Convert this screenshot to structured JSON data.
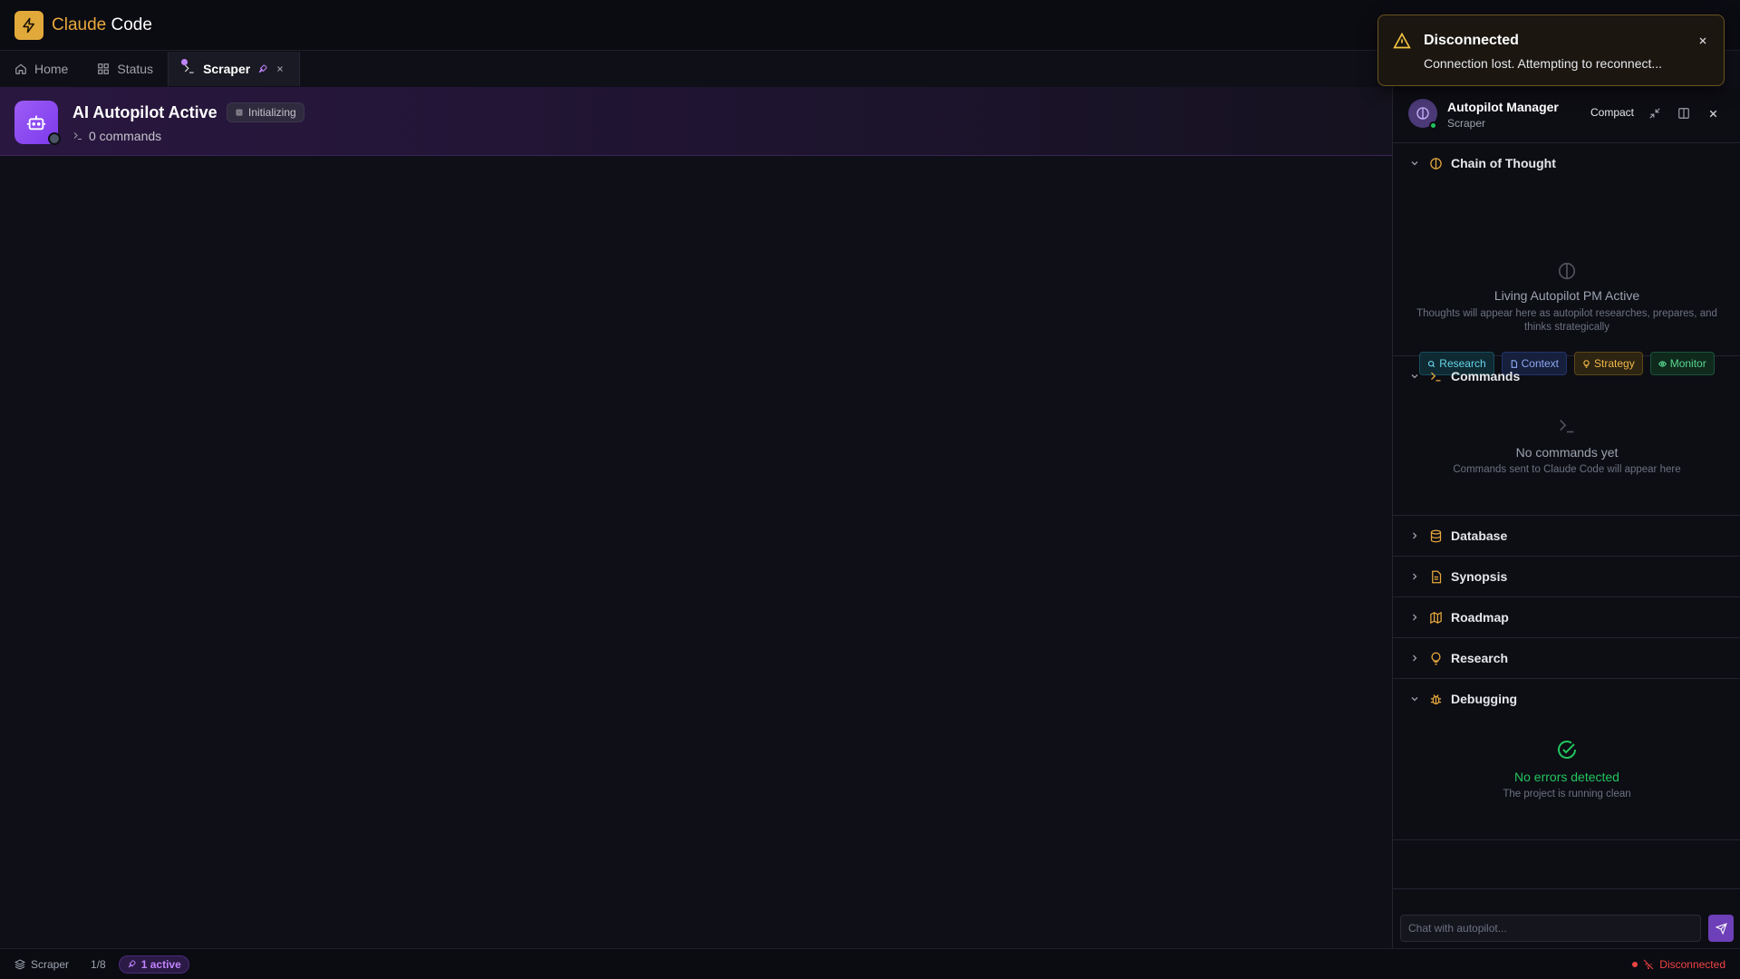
{
  "app": {
    "title_brand": "Claude",
    "title_rest": " Code"
  },
  "tabs": [
    {
      "label": "Home",
      "icon": "home-icon"
    },
    {
      "label": "Status",
      "icon": "grid-icon"
    },
    {
      "label": "Scraper",
      "icon": "terminal-icon",
      "active": true
    }
  ],
  "banner": {
    "title": "AI Autopilot Active",
    "badge": "Initializing",
    "commands_count": "0 commands"
  },
  "panel": {
    "title": "Autopilot Manager",
    "subtitle": "Scraper",
    "compact_label": "Compact",
    "sections": {
      "chain": {
        "title": "Chain of Thought",
        "empty_title": "Living Autopilot PM Active",
        "empty_sub": "Thoughts will appear here as autopilot researches, prepares, and thinks strategically",
        "chips": [
          "Research",
          "Context",
          "Strategy",
          "Monitor"
        ]
      },
      "commands": {
        "title": "Commands",
        "empty_title": "No commands yet",
        "empty_sub": "Commands sent to Claude Code will appear here"
      },
      "database": {
        "title": "Database"
      },
      "synopsis": {
        "title": "Synopsis"
      },
      "roadmap": {
        "title": "Roadmap"
      },
      "research": {
        "title": "Research"
      },
      "debugging": {
        "title": "Debugging",
        "empty_title": "No errors detected",
        "empty_sub": "The project is running clean"
      }
    },
    "chat_placeholder": "Chat with autopilot..."
  },
  "statusbar": {
    "project": "Scraper",
    "page": "1/8",
    "active": "1 active",
    "connection": "Disconnected"
  },
  "toast": {
    "title": "Disconnected",
    "message": "Connection lost. Attempting to reconnect..."
  },
  "colors": {
    "brand": "#e1a93a",
    "accent_purple": "#8b5cf6",
    "success": "#22c55e",
    "error": "#ef4444",
    "warning": "#f5c542"
  }
}
